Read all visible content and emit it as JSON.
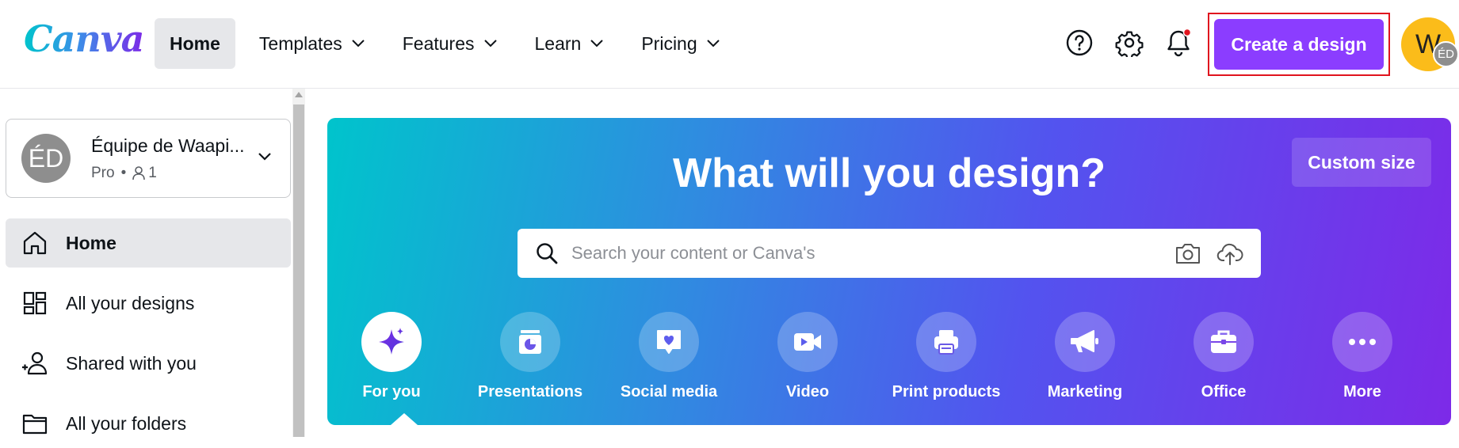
{
  "brand": {
    "logo_text": "Canva",
    "accent": "#8b3dff"
  },
  "nav": {
    "items": [
      {
        "label": "Home",
        "active": true,
        "dropdown": false
      },
      {
        "label": "Templates",
        "active": false,
        "dropdown": true
      },
      {
        "label": "Features",
        "active": false,
        "dropdown": true
      },
      {
        "label": "Learn",
        "active": false,
        "dropdown": true
      },
      {
        "label": "Pricing",
        "active": false,
        "dropdown": true
      }
    ],
    "icons": [
      "help-icon",
      "settings-icon",
      "notification-bell-icon"
    ],
    "create_label": "Create a design",
    "avatar_initial": "W",
    "avatar_badge": "ÉD"
  },
  "sidebar": {
    "team": {
      "initials": "ÉD",
      "name": "Équipe de Waapi...",
      "plan": "Pro",
      "members": "1"
    },
    "items": [
      {
        "label": "Home",
        "icon": "home-icon",
        "active": true
      },
      {
        "label": "All your designs",
        "icon": "grid-icon",
        "active": false
      },
      {
        "label": "Shared with you",
        "icon": "people-icon",
        "active": false
      },
      {
        "label": "All your folders",
        "icon": "folder-icon",
        "active": false
      }
    ]
  },
  "hero": {
    "title": "What will you design?",
    "custom_size": "Custom size",
    "search_placeholder": "Search your content or Canva's",
    "categories": [
      {
        "label": "For you",
        "icon": "sparkle-icon",
        "active": true
      },
      {
        "label": "Presentations",
        "icon": "presentation-icon",
        "active": false
      },
      {
        "label": "Social media",
        "icon": "heart-chat-icon",
        "active": false
      },
      {
        "label": "Video",
        "icon": "video-camera-icon",
        "active": false
      },
      {
        "label": "Print products",
        "icon": "printer-icon",
        "active": false
      },
      {
        "label": "Marketing",
        "icon": "megaphone-icon",
        "active": false
      },
      {
        "label": "Office",
        "icon": "briefcase-icon",
        "active": false
      },
      {
        "label": "More",
        "icon": "more-dots-icon",
        "active": false
      }
    ]
  }
}
